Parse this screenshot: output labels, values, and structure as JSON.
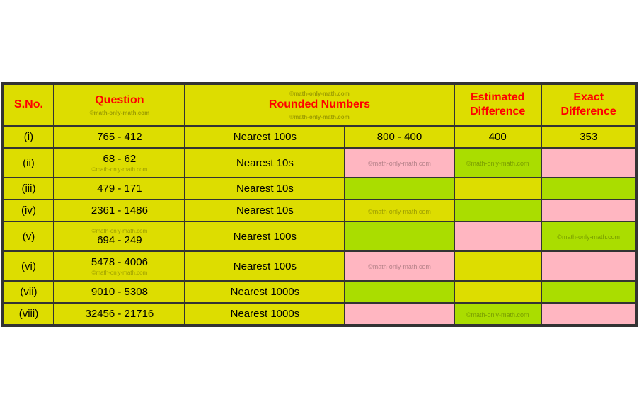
{
  "table": {
    "headers": {
      "sno": "S.No.",
      "question": "Question",
      "rounded_numbers": "Rounded Numbers",
      "estimated_diff": "Estimated Difference",
      "exact_diff": "Exact Difference",
      "watermark": "©math-only-math.com"
    },
    "rows": [
      {
        "sno": "(i)",
        "question": "765 - 412",
        "nearest": "Nearest 100s",
        "rounded_val": "800 - 400",
        "estimated": "400",
        "exact": "353",
        "nearest_bg": "yellow",
        "rounded_val_bg": "yellow",
        "estimated_bg": "yellow",
        "exact_bg": "yellow"
      },
      {
        "sno": "(ii)",
        "question": "68 - 62",
        "nearest": "Nearest 10s",
        "rounded_val": "",
        "estimated": "",
        "exact": "",
        "nearest_bg": "yellow",
        "rounded_val_bg": "pink",
        "estimated_bg": "green",
        "exact_bg": "pink"
      },
      {
        "sno": "(iii)",
        "question": "479 - 171",
        "nearest": "Nearest 10s",
        "rounded_val": "",
        "estimated": "",
        "exact": "",
        "nearest_bg": "yellow",
        "rounded_val_bg": "green",
        "estimated_bg": "yellow",
        "exact_bg": "green"
      },
      {
        "sno": "(iv)",
        "question": "2361 - 1486",
        "nearest": "Nearest 10s",
        "rounded_val": "",
        "estimated": "",
        "exact": "",
        "nearest_bg": "yellow",
        "rounded_val_bg": "yellow",
        "estimated_bg": "green",
        "exact_bg": "pink"
      },
      {
        "sno": "(v)",
        "question": "694 - 249",
        "nearest": "Nearest 100s",
        "rounded_val": "",
        "estimated": "",
        "exact": "",
        "nearest_bg": "yellow",
        "rounded_val_bg": "green",
        "estimated_bg": "pink",
        "exact_bg": "green"
      },
      {
        "sno": "(vi)",
        "question": "5478 - 4006",
        "nearest": "Nearest 100s",
        "rounded_val": "",
        "estimated": "",
        "exact": "",
        "nearest_bg": "yellow",
        "rounded_val_bg": "pink",
        "estimated_bg": "yellow",
        "exact_bg": "pink"
      },
      {
        "sno": "(vii)",
        "question": "9010 - 5308",
        "nearest": "Nearest 1000s",
        "rounded_val": "",
        "estimated": "",
        "exact": "",
        "nearest_bg": "yellow",
        "rounded_val_bg": "green",
        "estimated_bg": "yellow",
        "exact_bg": "green"
      },
      {
        "sno": "(viii)",
        "question": "32456 - 21716",
        "nearest": "Nearest 1000s",
        "rounded_val": "",
        "estimated": "",
        "exact": "",
        "nearest_bg": "yellow",
        "rounded_val_bg": "pink",
        "estimated_bg": "green",
        "exact_bg": "pink"
      }
    ]
  }
}
